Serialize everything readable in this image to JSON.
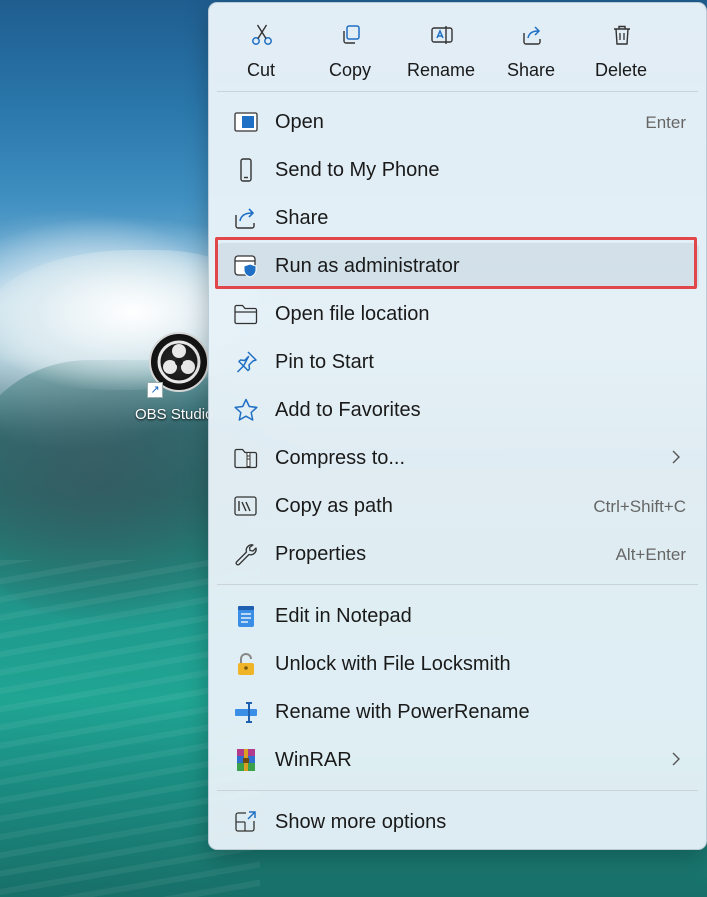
{
  "desktop": {
    "icon_label": "OBS Studio"
  },
  "toolbar": [
    {
      "id": "cut",
      "label": "Cut",
      "icon": "scissors-icon"
    },
    {
      "id": "copy",
      "label": "Copy",
      "icon": "copy-icon"
    },
    {
      "id": "rename",
      "label": "Rename",
      "icon": "rename-icon"
    },
    {
      "id": "share",
      "label": "Share",
      "icon": "share-icon"
    },
    {
      "id": "delete",
      "label": "Delete",
      "icon": "trash-icon"
    }
  ],
  "menu": {
    "items": [
      {
        "label": "Open",
        "shortcut": "Enter",
        "icon": "open-window-icon"
      },
      {
        "label": "Send to My Phone",
        "shortcut": "",
        "icon": "phone-icon"
      },
      {
        "label": "Share",
        "shortcut": "",
        "icon": "share-icon"
      },
      {
        "label": "Run as administrator",
        "shortcut": "",
        "icon": "admin-shield-icon",
        "highlighted": true
      },
      {
        "label": "Open file location",
        "shortcut": "",
        "icon": "folder-icon"
      },
      {
        "label": "Pin to Start",
        "shortcut": "",
        "icon": "pin-icon"
      },
      {
        "label": "Add to Favorites",
        "shortcut": "",
        "icon": "star-icon"
      },
      {
        "label": "Compress to...",
        "shortcut": "",
        "icon": "zip-folder-icon",
        "submenu": true
      },
      {
        "label": "Copy as path",
        "shortcut": "Ctrl+Shift+C",
        "icon": "copy-path-icon"
      },
      {
        "label": "Properties",
        "shortcut": "Alt+Enter",
        "icon": "wrench-icon"
      }
    ],
    "extra_items": [
      {
        "label": "Edit in Notepad",
        "icon": "notepad-icon"
      },
      {
        "label": "Unlock with File Locksmith",
        "icon": "lock-icon"
      },
      {
        "label": "Rename with PowerRename",
        "icon": "powerrename-icon"
      },
      {
        "label": "WinRAR",
        "icon": "winrar-icon",
        "submenu": true
      }
    ],
    "more": {
      "label": "Show more options",
      "icon": "more-options-icon"
    }
  },
  "colors": {
    "highlight_border": "#e0464a",
    "accent": "#1a6fd1"
  }
}
